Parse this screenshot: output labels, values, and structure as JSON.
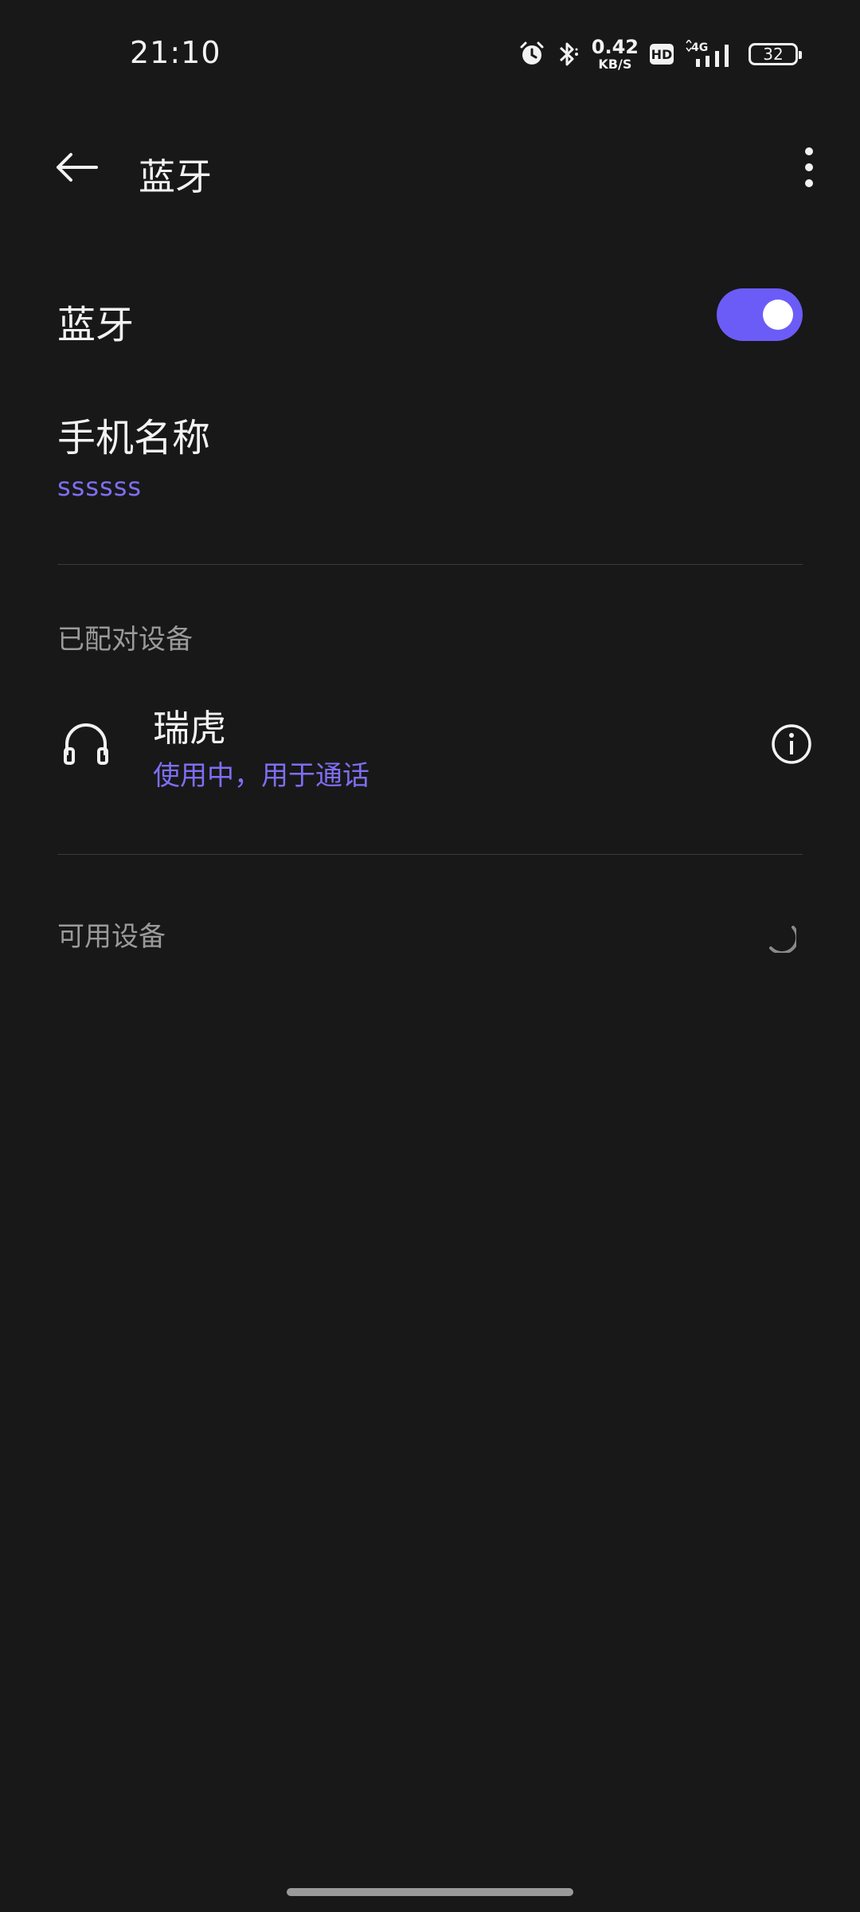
{
  "status_bar": {
    "time": "21:10",
    "net_speed_value": "0.42",
    "net_speed_unit": "KB/S",
    "hd_label": "HD",
    "network_type": "4G",
    "battery_level": "32",
    "icons": [
      "alarm-icon",
      "bluetooth-icon",
      "signal-icon"
    ]
  },
  "app_bar": {
    "title": "蓝牙",
    "back_icon": "arrow-left-icon",
    "more_icon": "more-vertical-icon"
  },
  "bluetooth_toggle": {
    "label": "蓝牙",
    "enabled": true
  },
  "phone_name": {
    "title": "手机名称",
    "value": "ssssss"
  },
  "paired_devices": {
    "header": "已配对设备",
    "items": [
      {
        "name": "瑞虎",
        "status": "使用中，用于通话",
        "icon": "headphones-icon"
      }
    ]
  },
  "available_devices": {
    "header": "可用设备"
  },
  "colors": {
    "accent": "#6c5cf7",
    "background": "#181818",
    "secondary_text": "#9a9a9a"
  }
}
